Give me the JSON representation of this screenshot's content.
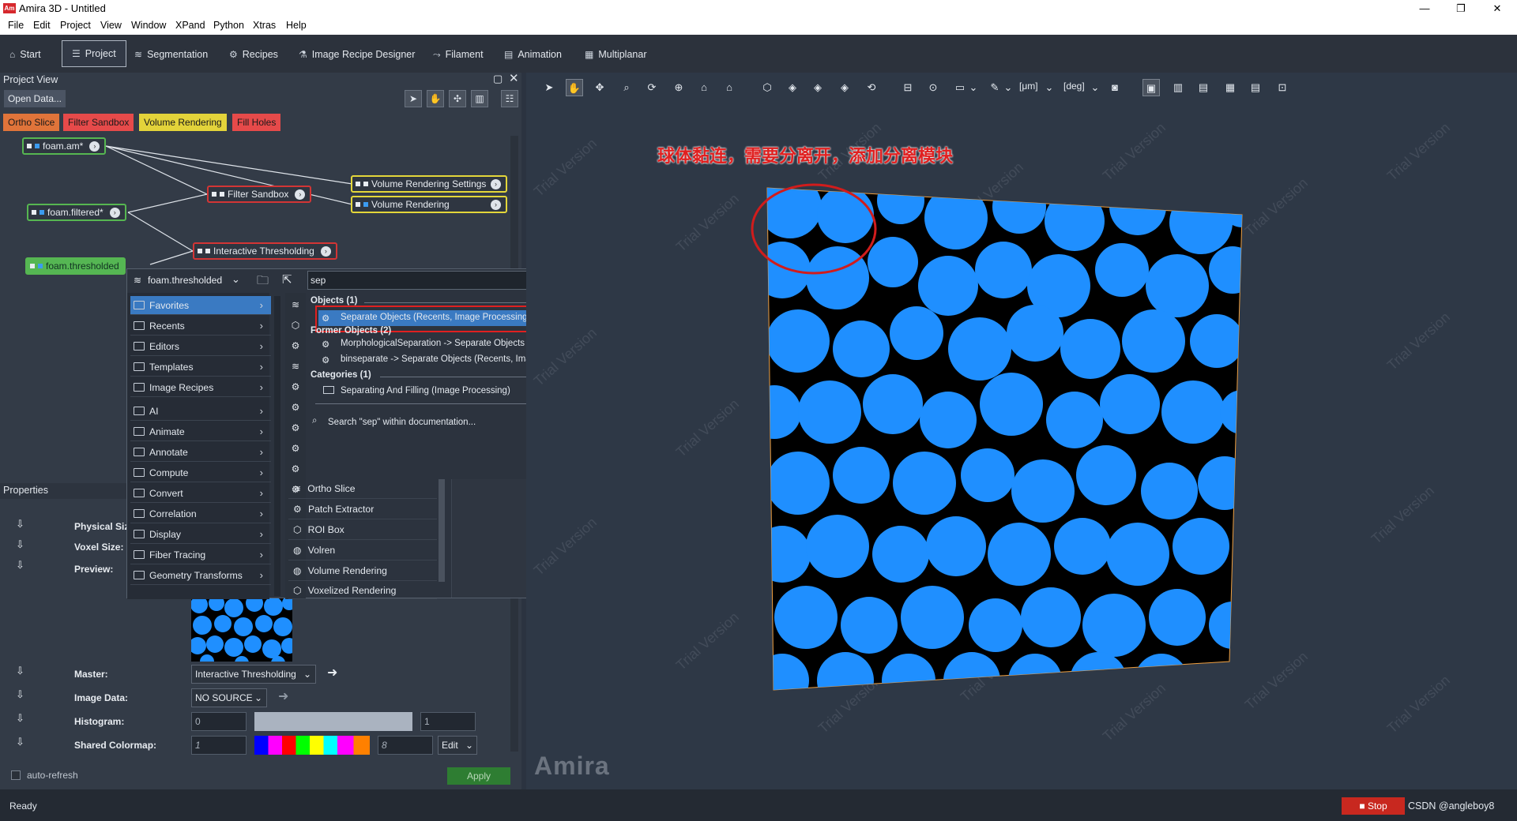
{
  "window": {
    "title": "Amira 3D - Untitled",
    "app_icon_text": "Am"
  },
  "menubar": [
    "File",
    "Edit",
    "Project",
    "View",
    "Window",
    "XPand",
    "Python",
    "Xtras",
    "Help"
  ],
  "workrooms": [
    {
      "label": "Start",
      "icon": "home-icon"
    },
    {
      "label": "Project",
      "icon": "project-icon",
      "active": true
    },
    {
      "label": "Segmentation",
      "icon": "layers-icon"
    },
    {
      "label": "Recipes",
      "icon": "gears-icon"
    },
    {
      "label": "Image Recipe Designer",
      "icon": "flask-icon"
    },
    {
      "label": "Filament",
      "icon": "filament-icon"
    },
    {
      "label": "Animation",
      "icon": "film-icon"
    },
    {
      "label": "Multiplanar",
      "icon": "multiplanar-icon"
    }
  ],
  "project": {
    "header": "Project View",
    "open_data": "Open Data...",
    "quick_modules": [
      {
        "label": "Ortho Slice",
        "color": "#e0743a"
      },
      {
        "label": "Filter Sandbox",
        "color": "#e64a4a"
      },
      {
        "label": "Volume Rendering",
        "color": "#e3d33a"
      },
      {
        "label": "Fill Holes",
        "color": "#e64a4a"
      }
    ],
    "nodes": {
      "foam_am": "foam.am*",
      "foam_filtered": "foam.filtered*",
      "foam_thresholded": "foam.thresholded",
      "filter_sandbox": "Filter Sandbox",
      "interactive_thresholding": "Interactive Thresholding",
      "vr_settings": "Volume Rendering Settings",
      "volume_rendering": "Volume Rendering"
    }
  },
  "popup": {
    "source": "foam.thresholded",
    "search": "sep",
    "categories": [
      "Favorites",
      "Recents",
      "Editors",
      "Templates",
      "Image Recipes",
      "AI",
      "Animate",
      "Annotate",
      "Compute",
      "Convert",
      "Correlation",
      "Display",
      "Fiber Tracing",
      "Geometry Transforms"
    ],
    "results": {
      "objects_header": "Objects (1)",
      "objects": [
        "Separate Objects (Recents, Image Processing>Separating And Fill"
      ],
      "former_header": "Former Objects (2)",
      "former": [
        "MorphologicalSeparation -> Separate Objects (Recents, Image Pr",
        "binseparate -> Separate Objects (Recents, Image Processing>Sep"
      ],
      "categories_header": "Categories (1)",
      "categories": [
        "Separating And Filling (Image Processing)"
      ],
      "doc_search": "Search \"sep\" within documentation..."
    },
    "modules": [
      "Ortho Slice",
      "Patch Extractor",
      "ROI Box",
      "Volren",
      "Volume Rendering",
      "Voxelized Rendering"
    ]
  },
  "properties": {
    "header": "Properties",
    "physical_size": "Physical Size:",
    "voxel_size": "Voxel Size:",
    "preview": "Preview:",
    "master_label": "Master:",
    "master_value": "Interactive Thresholding",
    "image_data_label": "Image Data:",
    "image_data_value": "NO SOURCE",
    "histogram_label": "Histogram:",
    "histogram_min": "0",
    "histogram_max": "1",
    "colormap_label": "Shared Colormap:",
    "colormap_min": "1",
    "colormap_max": "8",
    "edit": "Edit",
    "auto_refresh": "auto-refresh",
    "apply": "Apply"
  },
  "viewer": {
    "units_um": "[μm]",
    "units_deg": "[deg]",
    "annotation": "球体黏连，需要分离开，添加分离模块",
    "watermark": "Trial Version",
    "brand": "Amira",
    "colors": {
      "particle": "#1f8fff",
      "annotation": "#e02020"
    }
  },
  "statusbar": {
    "status": "Ready",
    "stop": "Stop",
    "credit": "CSDN @angleboy8"
  }
}
